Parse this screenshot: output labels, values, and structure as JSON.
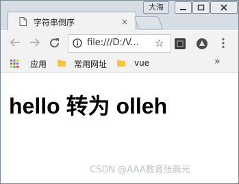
{
  "window": {
    "user_badge": "大海"
  },
  "tab": {
    "title": "字符串倒序",
    "close_glyph": "×"
  },
  "toolbar": {
    "url": "file:///D:/V...",
    "star_glyph": "☆"
  },
  "bookmarks": {
    "items": [
      {
        "label": "应用",
        "icon": "apps-grid-icon"
      },
      {
        "label": "常用网址",
        "icon": "folder-icon"
      },
      {
        "label": "vue",
        "icon": "folder-icon"
      }
    ],
    "more_glyph": "»"
  },
  "page": {
    "heading": "hello 转为 olleh"
  },
  "watermark": "CSDN @AAA教育张晨光",
  "colors": {
    "chrome_frame": "#d7dde5",
    "toolbar": "#f2f2f2",
    "folder": "#f4c542"
  }
}
